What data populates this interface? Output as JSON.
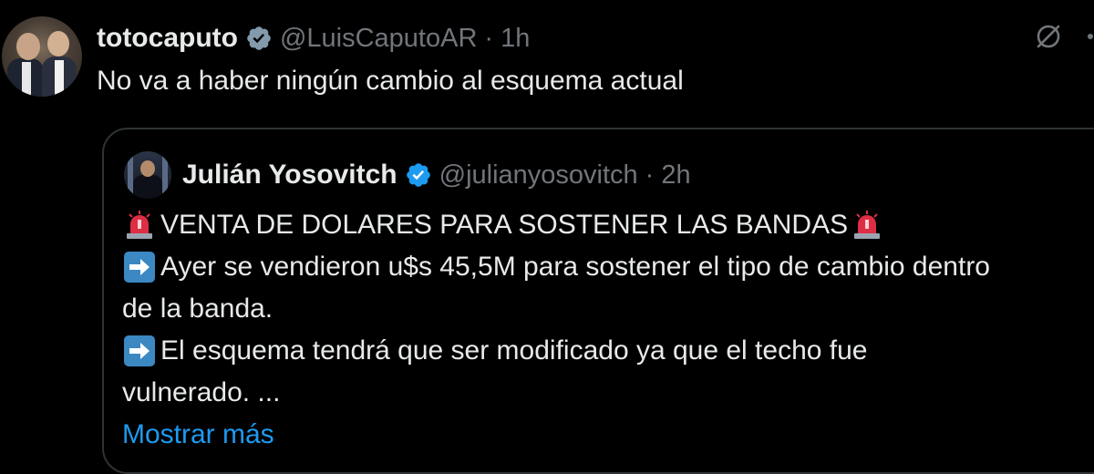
{
  "tweet": {
    "display_name": "totocaputo",
    "handle": "@LuisCaputoAR",
    "separator": "·",
    "time": "1h",
    "text": "No va a haber ningún cambio al esquema actual"
  },
  "quote": {
    "display_name": "Julián Yosovitch",
    "handle": "@julianyosovitch",
    "separator": "·",
    "time": "2h",
    "lines": [
      "VENTA DE DOLARES PARA SOSTENER LAS BANDAS",
      "Ayer se vendieron u$s 45,5M para sostener el tipo de cambio dentro",
      "de la banda.",
      "El esquema tendrá que ser modificado ya que el techo fue",
      "vulnerado. ..."
    ],
    "show_more": "Mostrar más"
  },
  "icons": {
    "verified": "verified-badge-icon",
    "grok": "grok-icon",
    "more": "more-icon",
    "siren": "siren-emoji",
    "arrow": "right-arrow-emoji"
  },
  "colors": {
    "background": "#000000",
    "text": "#e7e9ea",
    "secondary": "#71767b",
    "accent": "#1d9bf0",
    "border": "#2f3336"
  }
}
